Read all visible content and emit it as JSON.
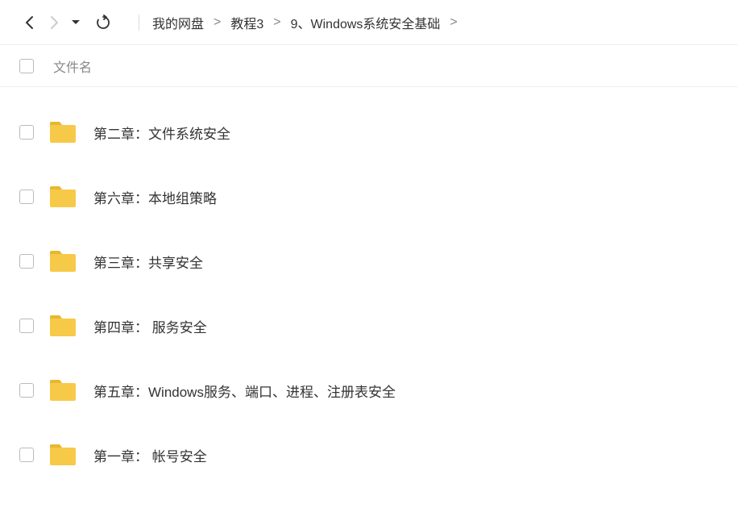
{
  "breadcrumb": {
    "items": [
      "我的网盘",
      "教程3",
      "9、Windows系统安全基础"
    ]
  },
  "header": {
    "filename_col": "文件名"
  },
  "files": [
    {
      "name": "第二章：文件系统安全"
    },
    {
      "name": "第六章：本地组策略"
    },
    {
      "name": "第三章：共享安全"
    },
    {
      "name": "第四章： 服务安全"
    },
    {
      "name": "第五章：Windows服务、端口、进程、注册表安全"
    },
    {
      "name": "第一章： 帐号安全"
    }
  ]
}
